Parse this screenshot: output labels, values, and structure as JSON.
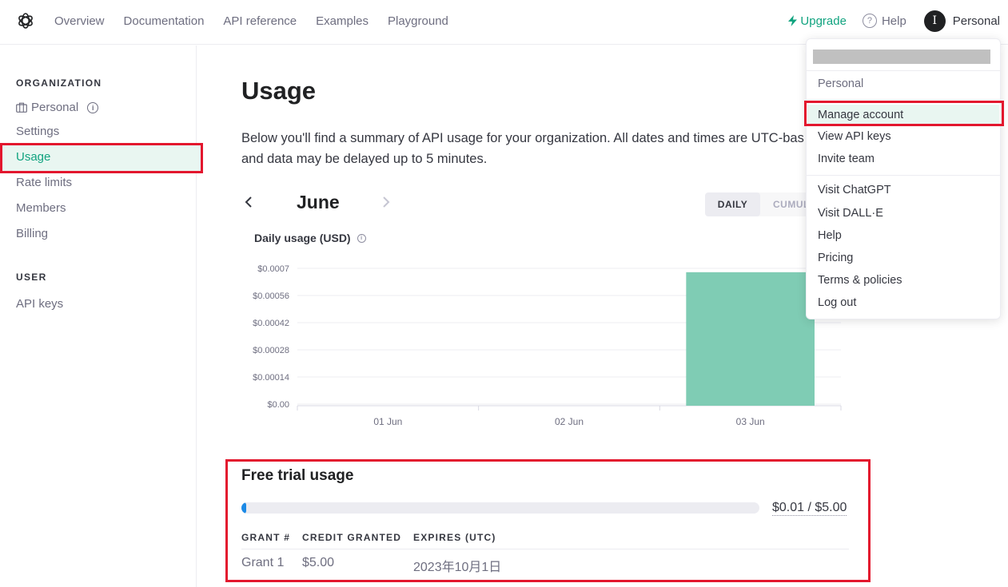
{
  "nav": {
    "links": [
      "Overview",
      "Documentation",
      "API reference",
      "Examples",
      "Playground"
    ],
    "upgrade": "Upgrade",
    "help": "Help",
    "avatar_initial": "I",
    "account_name": "Personal"
  },
  "sidebar": {
    "org_label": "ORGANIZATION",
    "org_name": "Personal",
    "org_items": [
      "Settings",
      "Usage",
      "Rate limits",
      "Members",
      "Billing"
    ],
    "active_item": "Usage",
    "user_label": "USER",
    "user_items": [
      "API keys"
    ]
  },
  "main": {
    "title": "Usage",
    "description_line1": "Below you'll find a summary of API usage for your organization. All dates and times are UTC-bas",
    "description_line2": "and data may be delayed up to 5 minutes.",
    "month": "June",
    "toggle_daily": "DAILY",
    "toggle_cumulative": "CUMUL",
    "chart_title": "Daily usage (USD)"
  },
  "chart_data": {
    "type": "bar",
    "title": "Daily usage (USD)",
    "categories": [
      "01 Jun",
      "02 Jun",
      "03 Jun"
    ],
    "values": [
      0,
      0,
      0.00068
    ],
    "y_ticks": [
      "$0.00",
      "$0.00014",
      "$0.00028",
      "$0.00042",
      "$0.00056",
      "$0.0007"
    ],
    "ylim": [
      0,
      0.0007
    ],
    "grid": true,
    "bar_color": "#7fccb4"
  },
  "free_trial": {
    "title": "Free trial usage",
    "used": 0.01,
    "total": 5.0,
    "progress_text": "$0.01 / $5.00",
    "headers": [
      "GRANT #",
      "CREDIT GRANTED",
      "EXPIRES (UTC)"
    ],
    "rows": [
      [
        "Grant 1",
        "$5.00",
        "2023年10月1日"
      ]
    ]
  },
  "dropdown": {
    "account_label": "Personal",
    "group1": [
      "Manage account",
      "View API keys",
      "Invite team"
    ],
    "group2": [
      "Visit ChatGPT",
      "Visit DALL·E",
      "Help",
      "Pricing",
      "Terms & policies",
      "Log out"
    ]
  },
  "colors": {
    "accent": "#10a37f",
    "highlight_bg": "#e9f6f1",
    "annotation_red": "#e3172e",
    "progress": "#1c8ae6"
  }
}
